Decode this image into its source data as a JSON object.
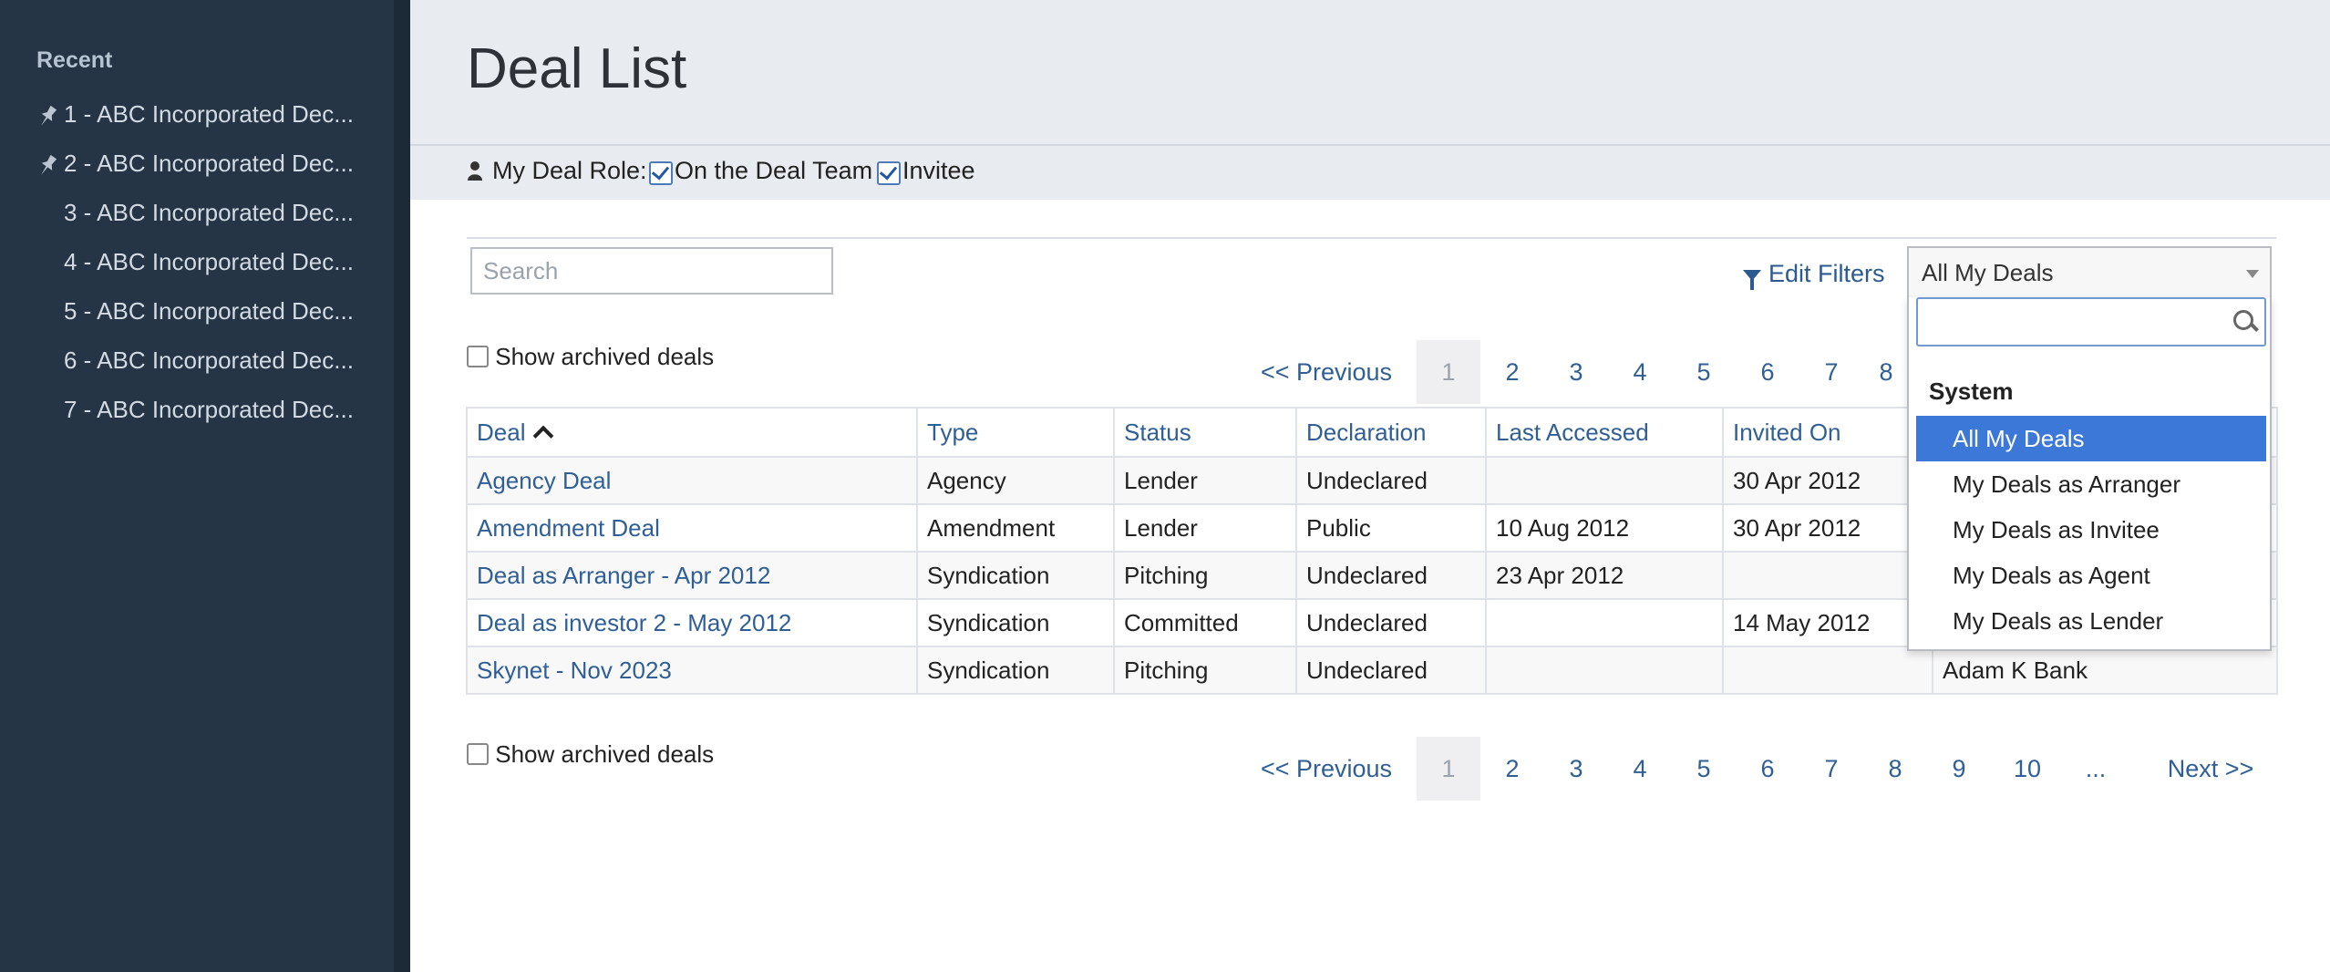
{
  "sidebar": {
    "heading": "Recent",
    "items": [
      {
        "label": "1 - ABC Incorporated Dec..."
      },
      {
        "label": "2 - ABC Incorporated Dec..."
      },
      {
        "label": "3 - ABC Incorporated Dec..."
      },
      {
        "label": "4 - ABC Incorporated Dec..."
      },
      {
        "label": "5 - ABC Incorporated Dec..."
      },
      {
        "label": "6 - ABC Incorporated Dec..."
      },
      {
        "label": "7 - ABC Incorporated Dec..."
      }
    ]
  },
  "header": {
    "title": "Deal List",
    "role_label": "My Deal Role:",
    "role_options": [
      "On the Deal Team",
      "Invitee"
    ]
  },
  "toolbar": {
    "search_placeholder": "Search",
    "edit_filters": "Edit Filters",
    "view_selected": "All My Deals"
  },
  "archived_label": "Show archived deals",
  "pagination": {
    "prev": "<< Previous",
    "next": "Next >>",
    "ellipsis": "...",
    "pages": [
      "1",
      "2",
      "3",
      "4",
      "5",
      "6",
      "7",
      "8",
      "9",
      "10"
    ]
  },
  "table": {
    "columns": [
      "Deal",
      "Type",
      "Status",
      "Declaration",
      "Last Accessed",
      "Invited On",
      ""
    ],
    "rows": [
      [
        "Agency Deal",
        "Agency",
        "Lender",
        "Undeclared",
        "",
        "30 Apr 2012",
        ""
      ],
      [
        "Amendment Deal",
        "Amendment",
        "Lender",
        "Public",
        "10 Aug 2012",
        "30 Apr 2012",
        ""
      ],
      [
        "Deal as Arranger - Apr 2012",
        "Syndication",
        "Pitching",
        "Undeclared",
        "23 Apr 2012",
        "",
        ""
      ],
      [
        "Deal as investor 2 - May 2012",
        "Syndication",
        "Committed",
        "Undeclared",
        "",
        "14 May 2012",
        ""
      ],
      [
        "Skynet - Nov 2023",
        "Syndication",
        "Pitching",
        "Undeclared",
        "",
        "",
        "Adam K Bank"
      ]
    ]
  },
  "dropdown": {
    "group": "System",
    "options": [
      "All My Deals",
      "My Deals as Arranger",
      "My Deals as Invitee",
      "My Deals as Agent",
      "My Deals as Lender"
    ]
  }
}
